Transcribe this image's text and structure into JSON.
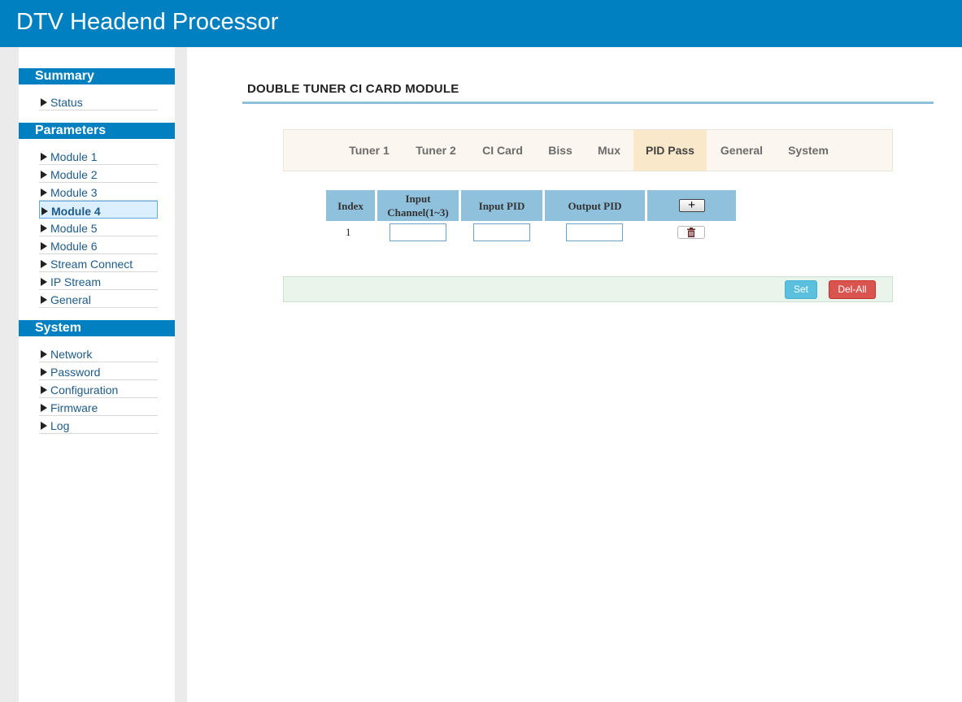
{
  "header": {
    "title": "DTV Headend Processor"
  },
  "sidebar": {
    "summary": {
      "heading": "Summary",
      "items": [
        "Status"
      ]
    },
    "parameters": {
      "heading": "Parameters",
      "items": [
        "Module 1",
        "Module 2",
        "Module 3",
        "Module 4",
        "Module 5",
        "Module 6",
        "Stream Connect",
        "IP Stream",
        "General"
      ],
      "active": "Module 4"
    },
    "system": {
      "heading": "System",
      "items": [
        "Network",
        "Password",
        "Configuration",
        "Firmware",
        "Log"
      ]
    }
  },
  "main": {
    "title": "DOUBLE TUNER CI CARD MODULE",
    "tabs": [
      "Tuner 1",
      "Tuner 2",
      "CI Card",
      "Biss",
      "Mux",
      "PID Pass",
      "General",
      "System"
    ],
    "active_tab": "PID Pass",
    "table": {
      "headers": [
        "Index",
        "Input Channel(1~3)",
        "Input PID",
        "Output PID"
      ],
      "add_symbol": "+",
      "rows": [
        {
          "index": "1",
          "input_channel": "",
          "input_pid": "",
          "output_pid": ""
        }
      ]
    },
    "buttons": {
      "set": "Set",
      "del_all": "Del-All"
    }
  },
  "colors": {
    "header_bg": "#0080c0",
    "table_head": "#8fc0dc",
    "active_tab": "#f9e8c9",
    "set_btn": "#5bc0de",
    "delall_btn": "#d9534f"
  },
  "icons": {
    "add": "plus-icon",
    "delete": "trash-icon",
    "nav": "triangle-right-icon"
  }
}
